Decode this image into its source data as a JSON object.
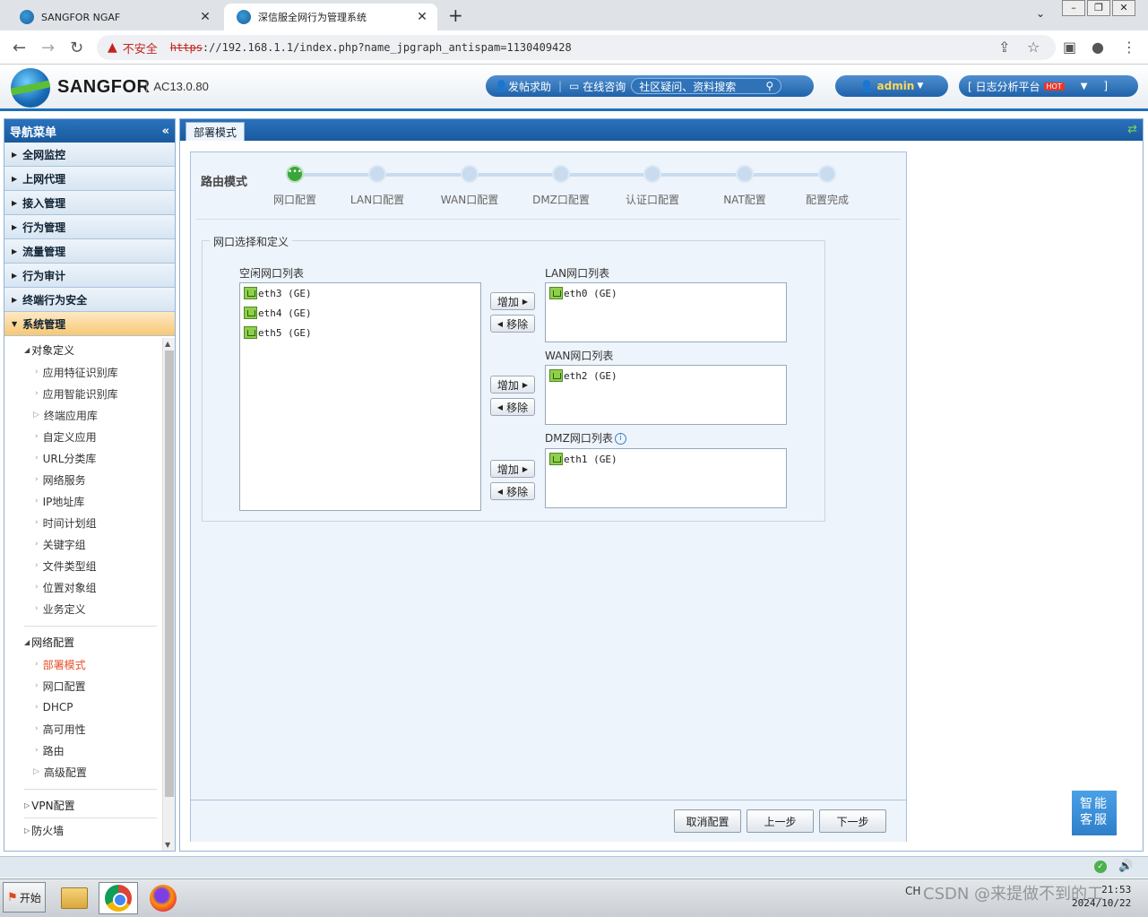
{
  "browser": {
    "tabs": [
      {
        "title": "SANGFOR NGAF"
      },
      {
        "title": "深信服全网行为管理系统"
      }
    ],
    "security_label": "不安全",
    "url_scheme": "https",
    "url_rest": "://192.168.1.1/index.php?name_jpgraph_antispam=1130409428"
  },
  "header": {
    "brand": "SANGFOR",
    "version": "AC13.0.80",
    "help": "发帖求助",
    "consult": "在线咨询",
    "search_placeholder": "社区疑问、资料搜索",
    "user": "admin",
    "log_platform": "[ 日志分析平台",
    "log_bracket": "]",
    "hot": "HOT"
  },
  "nav": {
    "title": "导航菜单",
    "main_items": [
      {
        "label": "全网监控"
      },
      {
        "label": "上网代理"
      },
      {
        "label": "接入管理"
      },
      {
        "label": "行为管理"
      },
      {
        "label": "流量管理"
      },
      {
        "label": "行为审计"
      },
      {
        "label": "终端行为安全"
      },
      {
        "label": "系统管理"
      }
    ],
    "groups": {
      "objects": "对象定义",
      "network": "网络配置",
      "vpn": "VPN配置",
      "firewall": "防火墙"
    },
    "object_items": [
      "应用特征识别库",
      "应用智能识别库",
      "终端应用库",
      "自定义应用",
      "URL分类库",
      "网络服务",
      "IP地址库",
      "时间计划组",
      "关键字组",
      "文件类型组",
      "位置对象组",
      "业务定义"
    ],
    "network_items": [
      "部署模式",
      "网口配置",
      "DHCP",
      "高可用性",
      "路由",
      "高级配置"
    ]
  },
  "main": {
    "tab": "部署模式",
    "mode_title": "路由模式",
    "steps": [
      "网口配置",
      "LAN口配置",
      "WAN口配置",
      "DMZ口配置",
      "认证口配置",
      "NAT配置",
      "配置完成"
    ],
    "fieldset_legend": "网口选择和定义",
    "idle_label": "空闲网口列表",
    "idle_ifaces": [
      "eth3 (GE)",
      "eth4 (GE)",
      "eth5 (GE)"
    ],
    "lan_label": "LAN网口列表",
    "lan_ifaces": [
      "eth0 (GE)"
    ],
    "wan_label": "WAN网口列表",
    "wan_ifaces": [
      "eth2 (GE)"
    ],
    "dmz_label": "DMZ网口列表",
    "dmz_ifaces": [
      "eth1 (GE)"
    ],
    "add_label": "增加",
    "remove_label": "移除",
    "cancel_label": "取消配置",
    "prev_label": "上一步",
    "next_label": "下一步"
  },
  "robot": {
    "line1": "智能",
    "line2": "客服"
  },
  "taskbar": {
    "start": "开始",
    "ime": "CH",
    "time": "21:53",
    "date": "2024/10/22",
    "watermark": "CSDN @来提做不到的工"
  }
}
